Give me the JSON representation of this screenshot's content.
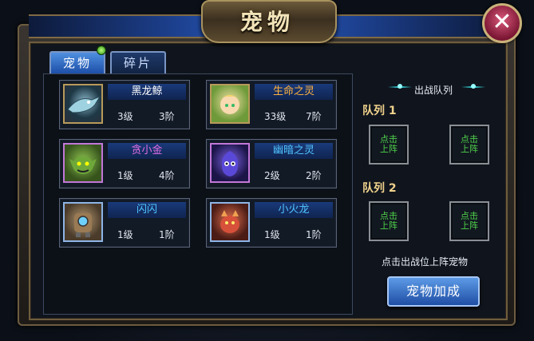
{
  "window": {
    "title": "宠物",
    "close_icon": "✕"
  },
  "tabs": [
    {
      "label": "宠物",
      "active": true
    },
    {
      "label": "碎片",
      "active": false
    }
  ],
  "pets": [
    {
      "name": "黑龙鲸",
      "name_color": "#ffffff",
      "level": "3级",
      "rank": "3阶",
      "avatar_icon": "black-dragon-whale-avatar"
    },
    {
      "name": "生命之灵",
      "name_color": "#ffb13d",
      "level": "33级",
      "rank": "7阶",
      "avatar_icon": "life-spirit-avatar"
    },
    {
      "name": "贪小金",
      "name_color": "#e36de6",
      "level": "1级",
      "rank": "4阶",
      "avatar_icon": "goblin-avatar"
    },
    {
      "name": "幽暗之灵",
      "name_color": "#4fc3ff",
      "level": "2级",
      "rank": "2阶",
      "avatar_icon": "dark-spirit-avatar"
    },
    {
      "name": "闪闪",
      "name_color": "#4fc3ff",
      "level": "1级",
      "rank": "1阶",
      "avatar_icon": "robot-avatar"
    },
    {
      "name": "小火龙",
      "name_color": "#4fc3ff",
      "level": "1级",
      "rank": "1阶",
      "avatar_icon": "fire-dragon-avatar"
    }
  ],
  "battle": {
    "title": "出战队列",
    "queues": [
      {
        "label": "队列 1",
        "slots": [
          "点击\n上阵",
          "点击\n上阵"
        ]
      },
      {
        "label": "队列 2",
        "slots": [
          "点击\n上阵",
          "点击\n上阵"
        ]
      }
    ],
    "hint": "点击出战位上阵宠物",
    "bonus_button": "宠物加成"
  }
}
